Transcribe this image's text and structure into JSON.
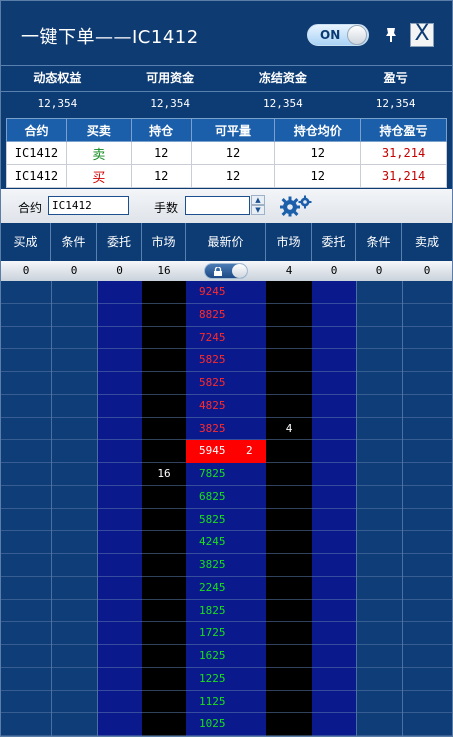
{
  "window": {
    "title": "一键下单——IC1412",
    "toggle_label": "ON",
    "close_label": "X"
  },
  "account": {
    "headers": [
      "动态权益",
      "可用资金",
      "冻结资金",
      "盈亏"
    ],
    "values": [
      "12,354",
      "12,354",
      "12,354",
      "12,354"
    ]
  },
  "positions": {
    "headers": [
      "合约",
      "买卖",
      "持仓",
      "可平量",
      "持仓均价",
      "持仓盈亏"
    ],
    "rows": [
      {
        "contract": "IC1412",
        "side": "卖",
        "hold": "12",
        "closable": "12",
        "avg": "12",
        "pl": "31,214"
      },
      {
        "contract": "IC1412",
        "side": "买",
        "hold": "12",
        "closable": "12",
        "avg": "12",
        "pl": "31,214"
      }
    ]
  },
  "order_bar": {
    "contract_label": "合约",
    "contract_value": "IC1412",
    "qty_label": "手数",
    "qty_value": ""
  },
  "ladder": {
    "headers": [
      "买成",
      "条件",
      "委托",
      "市场",
      "最新价",
      "市场",
      "委托",
      "条件",
      "卖成"
    ],
    "summary": [
      "0",
      "0",
      "0",
      "16",
      "",
      "4",
      "0",
      "0",
      "0"
    ],
    "rows": [
      {
        "price": "9245",
        "type": "ask"
      },
      {
        "price": "8825",
        "type": "ask"
      },
      {
        "price": "7245",
        "type": "ask"
      },
      {
        "price": "5825",
        "type": "ask"
      },
      {
        "price": "5825",
        "type": "ask"
      },
      {
        "price": "4825",
        "type": "ask"
      },
      {
        "price": "3825",
        "type": "ask",
        "ask_market": "4"
      },
      {
        "price": "5945",
        "type": "last",
        "last_vol": "2"
      },
      {
        "price": "7825",
        "type": "bid",
        "bid_market": "16"
      },
      {
        "price": "6825",
        "type": "bid"
      },
      {
        "price": "5825",
        "type": "bid"
      },
      {
        "price": "4245",
        "type": "bid"
      },
      {
        "price": "3825",
        "type": "bid"
      },
      {
        "price": "2245",
        "type": "bid"
      },
      {
        "price": "1825",
        "type": "bid"
      },
      {
        "price": "1725",
        "type": "bid"
      },
      {
        "price": "1625",
        "type": "bid"
      },
      {
        "price": "1225",
        "type": "bid"
      },
      {
        "price": "1125",
        "type": "bid"
      },
      {
        "price": "1025",
        "type": "bid"
      }
    ]
  },
  "colors": {
    "frame": "#0d3c74",
    "cell_dark_blue": "#0a1a8c",
    "cell_mid_blue": "#0f3d78",
    "cell_black": "#000000",
    "ask_price": "#ff2a2a",
    "bid_price": "#19e019",
    "last_price_bg": "#ff0000"
  }
}
